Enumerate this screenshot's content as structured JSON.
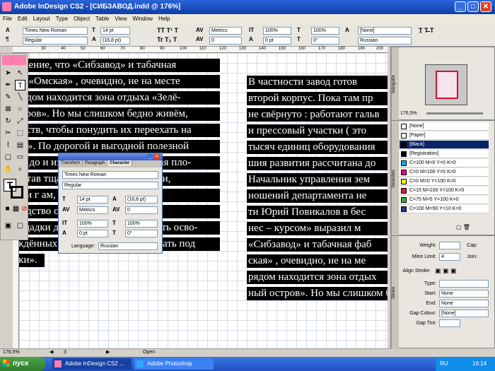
{
  "window": {
    "title": "Adobe InDesign CS2 - [СИБЗАВОД.indd @ 176%]"
  },
  "menu": [
    "File",
    "Edit",
    "Layout",
    "Type",
    "Object",
    "Table",
    "View",
    "Window",
    "Help"
  ],
  "control": {
    "font_family": "Times New Roman",
    "font_style": "Regular",
    "font_size": "14 pt",
    "leading": "(16,8 pt)",
    "kerning": "Metrics",
    "tracking": "0",
    "vscale": "100%",
    "hscale": "100%",
    "baseline": "0 pt",
    "skew": "0°",
    "char_style": "[None]",
    "language": "Russian"
  },
  "ruler_ticks": [
    "30",
    "40",
    "50",
    "60",
    "70",
    "80",
    "90",
    "100",
    "110",
    "120",
    "130",
    "140",
    "150",
    "160",
    "170",
    "180",
    "190",
    "200"
  ],
  "left_column": [
    "мнение, что «Сибзавод» и табачная",
    "ка «Омская» , очевидно, не на месте",
    "рядом находится зона отдыха «Зелё-",
    "стров». Но мы слишком бедно живём,",
    "едств, чтобы понудить их переехать на",
    "ну». По дорогой и выгодной полезной",
    "не до и изваленная и забронённая пло-",
    "остав тщательно в собственности,",
    "сли г                          ам, где про-",
    "водство ст                    устраивать",
    "ощадки для отдыха. Другую часть осво-",
    "ждённых территорий можно отдать под",
    "жи»."
  ],
  "right_column": [
    "В  частности  завод  готов",
    "второй корпус. Пока там пр",
    "не свёрнуто : работают гальв",
    "и  прессовый  участки  ( это",
    "тысяч единиц оборудования",
    "шия развития рассчитана до",
    "Начальник управления зем",
    "ношений  департамента  не",
    "ти Юрий Повикалов в бес",
    "нес  –  курсом»  выразил  м",
    "«Сибзавод» и табачная фаб",
    "ская» , очевидно, не на ме",
    "рядом находится зона отдых",
    "ный  остров».  Но мы слишком бедно"
  ],
  "char_panel": {
    "tabs": [
      "Transform",
      "Paragraph",
      "Character"
    ],
    "font_family": "Times New Roman",
    "font_style": "Regular",
    "font_size": "14 pt",
    "leading": "(16,8 pt)",
    "kerning": "Metrics",
    "tracking": "0",
    "vscale": "100%",
    "hscale": "100%",
    "baseline": "0 pt",
    "skew": "0°",
    "language_label": "Language:",
    "language": "Russian"
  },
  "navigator": {
    "tab": "Navigator",
    "zoom": "176,5%"
  },
  "swatches": {
    "tab": "Swatches",
    "items": [
      {
        "name": "[None]",
        "color": "#ffffff"
      },
      {
        "name": "[Paper]",
        "color": "#ffffff"
      },
      {
        "name": "[Black]",
        "color": "#000000"
      },
      {
        "name": "[Registration]",
        "color": "#000000"
      },
      {
        "name": "C=100 M=0 Y=0 K=0",
        "color": "#00aeef"
      },
      {
        "name": "C=0 M=100 Y=0 K=0",
        "color": "#ec008c"
      },
      {
        "name": "C=0 M=0 Y=100 K=0",
        "color": "#fff200"
      },
      {
        "name": "C=15 M=100 Y=100 K=0",
        "color": "#d2232a"
      },
      {
        "name": "C=75 M=5 Y=100 K=0",
        "color": "#3aa935"
      },
      {
        "name": "C=100 M=90 Y=10 K=0",
        "color": "#2e3192"
      }
    ]
  },
  "stroke": {
    "tab": "Stroke",
    "weight_label": "Weight:",
    "cap_label": "Cap:",
    "miter_label": "Mitre Limit:",
    "miter_value": "4",
    "join_label": "Join:",
    "align_label": "Align Stroke:",
    "type_label": "Type:",
    "start_label": "Start:",
    "start_value": "None",
    "end_label": "End:",
    "end_value": "None",
    "gap_colour_label": "Gap Colour:",
    "gap_colour_value": "[None]",
    "gap_tint_label": "Gap Tint:"
  },
  "status": {
    "zoom": "176,5%",
    "page": "3",
    "state": "Open"
  },
  "taskbar": {
    "start": "пуск",
    "tasks": [
      "Adobe InDesign CS2 ...",
      "Adobe Photoshop"
    ],
    "lang": "RU",
    "time": "16:14"
  }
}
